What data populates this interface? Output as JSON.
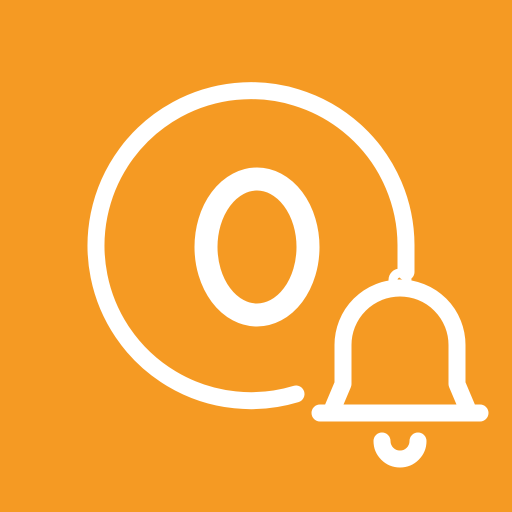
{
  "app_icon": {
    "name": "at-sign-notification-bell",
    "background_color": "#F59A23",
    "foreground_color": "#FFFFFF",
    "icons": [
      "at-sign-icon",
      "bell-icon"
    ]
  }
}
